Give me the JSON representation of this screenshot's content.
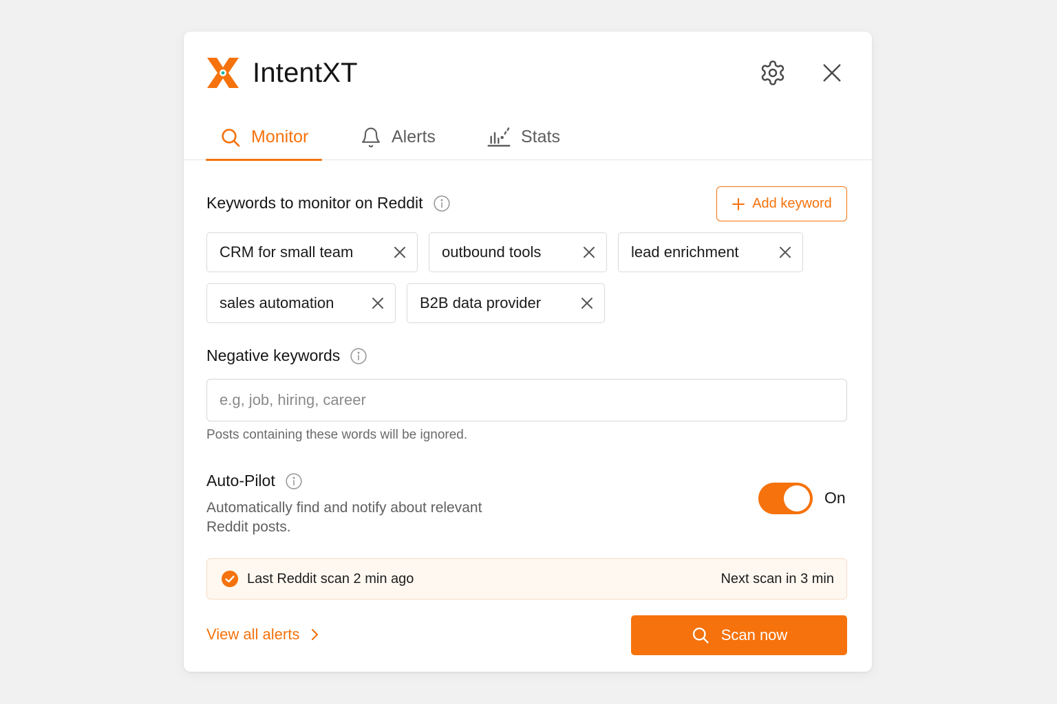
{
  "app": {
    "title": "IntentXT"
  },
  "header": {
    "settings_icon": "gear-icon",
    "close_icon": "close-icon"
  },
  "tabs": [
    {
      "label": "Monitor",
      "icon": "search-icon",
      "active": true
    },
    {
      "label": "Alerts",
      "icon": "bell-icon",
      "active": false
    },
    {
      "label": "Stats",
      "icon": "chart-icon",
      "active": false
    }
  ],
  "keywords": {
    "title": "Keywords to monitor on Reddit",
    "add_label": "Add keyword",
    "items": [
      "CRM for small team",
      "outbound tools",
      "lead enrichment",
      "sales automation",
      "B2B data provider"
    ]
  },
  "negative": {
    "title": "Negative keywords",
    "placeholder": "e.g, job, hiring, career",
    "value": "",
    "helper": "Posts containing these words will be ignored."
  },
  "autopilot": {
    "title": "Auto-Pilot",
    "description": "Automatically find and notify about relevant Reddit posts.",
    "enabled": true,
    "state_label": "On"
  },
  "status": {
    "last_scan": "Last Reddit scan 2 min ago",
    "next_scan": "Next scan in 3 min"
  },
  "footer": {
    "view_all": "View all alerts",
    "scan_now": "Scan now"
  },
  "colors": {
    "accent": "#f5720c",
    "status_bg": "#fff8f1",
    "text": "#1a1a1a",
    "muted": "#6a6a6a"
  }
}
